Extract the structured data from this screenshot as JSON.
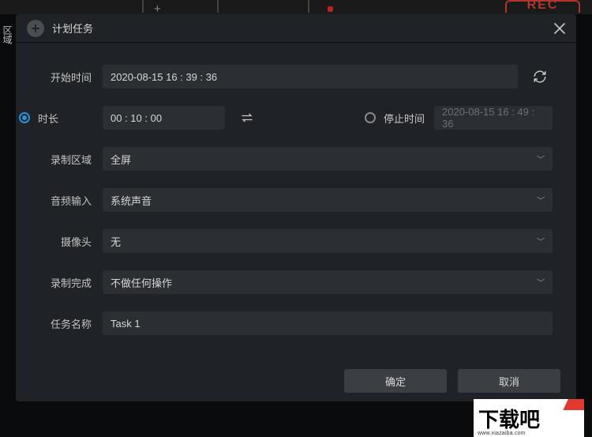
{
  "dialog": {
    "title": "计划任务"
  },
  "startTime": {
    "label": "开始时间",
    "value": "2020-08-15 16 : 39 : 36"
  },
  "duration": {
    "label": "时长",
    "value": "00 : 10 : 00"
  },
  "stopTime": {
    "label": "停止时间",
    "value": "2020-08-15 16 : 49 : 36"
  },
  "recordArea": {
    "label": "录制区域",
    "value": "全屏"
  },
  "audioInput": {
    "label": "音频输入",
    "value": "系统声音"
  },
  "camera": {
    "label": "摄像头",
    "value": "无"
  },
  "onComplete": {
    "label": "录制完成",
    "value": "不做任何操作"
  },
  "taskName": {
    "label": "任务名称",
    "value": "Task 1"
  },
  "buttons": {
    "ok": "确定",
    "cancel": "取消"
  },
  "bg": {
    "rec": "REC",
    "region": "区域"
  },
  "watermark": {
    "text": "下载吧",
    "url": "www.xiazaiba.com"
  }
}
